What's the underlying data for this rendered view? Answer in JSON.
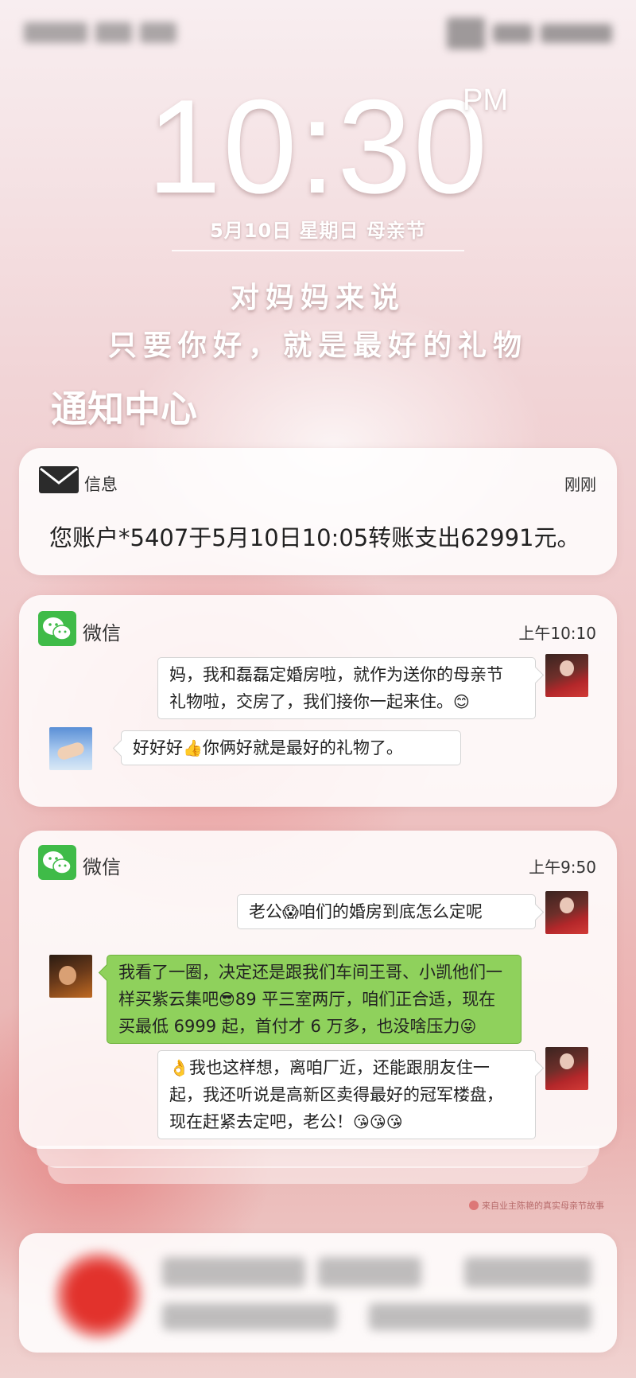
{
  "clock": {
    "time": "10:30",
    "ampm": "PM",
    "date": "5月10日  星期日  母亲节"
  },
  "slogan": {
    "line1": "对妈妈来说",
    "line2": "只要你好，就是最好的礼物"
  },
  "notification_center": {
    "title": "通知中心"
  },
  "sms": {
    "app": "信息",
    "time": "刚刚",
    "icon": "envelope-icon",
    "body": "您账户*5407于5月10日10:05转账支出62991元。"
  },
  "wechat1": {
    "app": "微信",
    "time": "上午10:10",
    "icon": "wechat-icon",
    "messages": [
      {
        "side": "right",
        "line1": "妈，我和磊磊定婚房啦，就作为送你的母亲节",
        "line2": "礼物啦，交房了，我们接你一起来住。",
        "emoji": "😊"
      },
      {
        "side": "left",
        "pre": "好好好",
        "emoji": "👍",
        "post": "你俩好就是最好的礼物了。"
      }
    ]
  },
  "wechat2": {
    "app": "微信",
    "time": "上午9:50",
    "icon": "wechat-icon",
    "messages": [
      {
        "side": "right",
        "pre": "老公",
        "emoji": "😱",
        "post": "咱们的婚房到底怎么定呢"
      },
      {
        "side": "left",
        "line1": "我看了一圈，决定还是跟我们车间王哥、小凯他们一",
        "line2a": "样买紫云集吧",
        "emoji1": "😎",
        "line2b": "89 平三室两厅，咱们正合适，现在",
        "line3": "买最低 6999 起，首付才 6 万多，也没啥压力",
        "emoji2": "😜"
      },
      {
        "side": "right",
        "emoji": "👌",
        "line1": "我也这样想，离咱厂近，还能跟朋友住一",
        "line2": "起，我还听说是高新区卖得最好的冠军楼盘，",
        "line3": "现在赶紧去定吧，老公！",
        "emojis": "😘😘😘"
      }
    ]
  },
  "footnote": "来自业主陈艳的真实母亲节故事",
  "colors": {
    "wechat_green": "#3fbb48",
    "bubble_green": "#8fd15c",
    "background_pink": "#eec3c3"
  }
}
